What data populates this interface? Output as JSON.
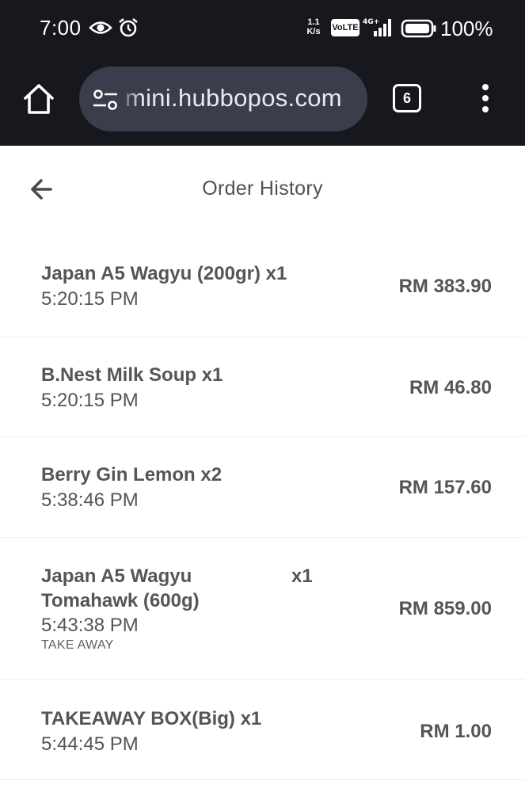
{
  "status_bar": {
    "time": "7:00",
    "net_speed_value": "1.1",
    "net_speed_unit": "K/s",
    "volte_label": "VoLTE",
    "network_label": "4G+",
    "battery": "100%"
  },
  "browser": {
    "url": "mini.hubbopos.com",
    "tab_count": "6"
  },
  "header": {
    "title": "Order History"
  },
  "orders": [
    {
      "name": "Japan A5 Wagyu (200gr) x1",
      "time": "5:20:15 PM",
      "price": "RM 383.90"
    },
    {
      "name": "B.Nest Milk Soup x1",
      "time": "5:20:15 PM",
      "price": "RM 46.80"
    },
    {
      "name": "Berry Gin Lemon x2",
      "time": "5:38:46 PM",
      "price": "RM 157.60"
    },
    {
      "name_line1": "Japan A5 Wagyu",
      "name_line2": "Tomahawk (600g)",
      "qty": "x1",
      "time": "5:43:38 PM",
      "note": "TAKE AWAY",
      "price": "RM 859.00"
    },
    {
      "name": "TAKEAWAY BOX(Big) x1",
      "time": "5:44:45 PM",
      "price": "RM 1.00"
    }
  ],
  "icons": {
    "status": [
      "eye-icon",
      "alarm-icon",
      "signal-icon",
      "battery-icon"
    ],
    "toolbar": [
      "home-icon",
      "site-settings-icon",
      "tabs-icon",
      "more-vert-icon"
    ],
    "header": [
      "arrow-back-icon"
    ]
  }
}
